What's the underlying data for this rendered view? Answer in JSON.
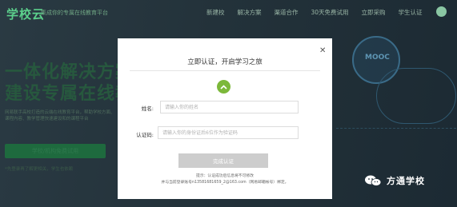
{
  "background": {
    "logo": "学校云",
    "slogan": "集成你的专属在线教育平台",
    "nav": [
      "新建校",
      "解决方案",
      "渠道合作",
      "30天免费试用",
      "立即采购",
      "学生认证"
    ],
    "hero_line1": "一体化解决方案",
    "hero_line2": "建设专属在线教",
    "description": "网易联手高校打造的云端在线教育平台，帮助学校方面、课程内容、教学管理快速建设和的课程平台",
    "trial_button": "学校/机构免费试用",
    "footnote": "*先登录再了解更相关，学生也依赖",
    "decor_label": "MOOC"
  },
  "modal": {
    "title": "立即认证，开启学习之旅",
    "name_label": "姓名:",
    "name_placeholder": "请输入你的姓名",
    "id_label": "认证码:",
    "id_placeholder": "请输入你的身份证后6位作为验证码",
    "submit_label": "完成认证",
    "tip_line1": "提示：认证成功后信息将不可修改",
    "tip_line2": "并与当前登录账号n13581681659_2@163.com（网易邮箱帐号）绑定。",
    "badge_color": "#7cb83a"
  },
  "watermark": {
    "text": "方通学校",
    "icon": "wechat-icon"
  }
}
